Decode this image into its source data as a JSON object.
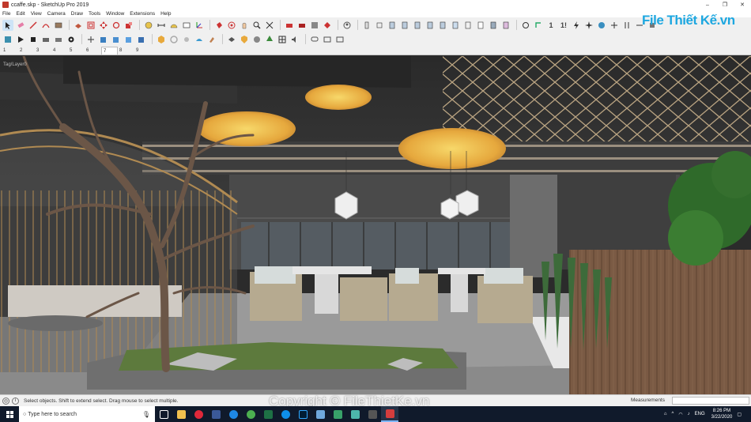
{
  "window": {
    "title": "ccaffe.skp - SketchUp Pro 2019",
    "controls": [
      "–",
      "❐",
      "✕"
    ]
  },
  "menu": [
    "File",
    "Edit",
    "View",
    "Camera",
    "Draw",
    "Tools",
    "Window",
    "Extensions",
    "Help"
  ],
  "scenes": [
    "1",
    "2",
    "3",
    "4",
    "5",
    "6",
    "7",
    "8",
    "9"
  ],
  "active_scene": "7",
  "logo": {
    "text": "File Thiết Kế.vn"
  },
  "viewport": {
    "layer_label": "Tag/Layer0"
  },
  "status": {
    "hint": "Select objects. Shift to extend select. Drag mouse to select multiple.",
    "measurements_label": "Measurements",
    "measurements_value": ""
  },
  "watermark": "Copyright © FileThietKe.vn",
  "taskbar": {
    "search_placeholder": "Type here to search",
    "language": "ENG",
    "time": "8:26 PM",
    "date": "3/22/2020"
  },
  "colors": {
    "accent_logo": "#1da7e0",
    "taskbar": "#101a2b",
    "toolbar": "#f0f0f0"
  }
}
